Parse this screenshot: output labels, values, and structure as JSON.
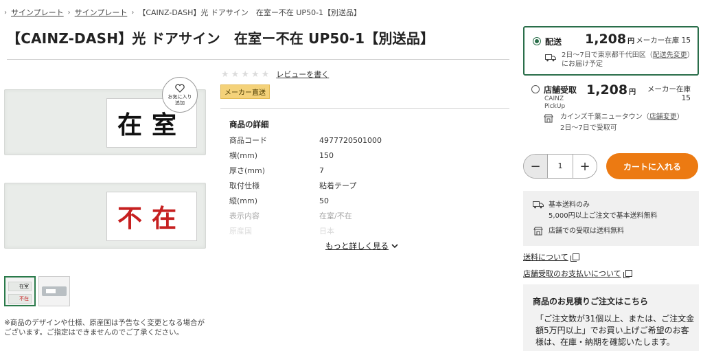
{
  "breadcrumb": {
    "items": [
      "サインプレート",
      "サインプレート",
      "【CAINZ-DASH】光 ドアサイン　在室ー不在 UP50-1【別送品】"
    ]
  },
  "product": {
    "title": "【CAINZ-DASH】光 ドアサイン　在室ー不在 UP50-1【別送品】",
    "image_text_top": "在室",
    "image_text_bottom": "不在",
    "favorite_label_1": "お気に入り",
    "favorite_label_2": "追加",
    "thumbs": [
      {
        "top": "在室",
        "bottom": "不在"
      },
      {
        "top": "",
        "bottom": ""
      }
    ],
    "disclaimer": "※商品のデザインや仕様、原産国は予告なく変更となる場合がございます。ご指定はできませんのでご了承ください。"
  },
  "rating": {
    "stars": 0,
    "review_link": "レビューを書く"
  },
  "badge": "メーカー直送",
  "details": {
    "title": "商品の詳細",
    "rows": [
      {
        "key": "商品コード",
        "value": "4977720501000"
      },
      {
        "key": "横(mm)",
        "value": "150"
      },
      {
        "key": "厚さ(mm)",
        "value": "7"
      },
      {
        "key": "取付仕様",
        "value": "粘着テープ"
      },
      {
        "key": "縦(mm)",
        "value": "50"
      },
      {
        "key": "表示内容",
        "value": "在室/不在"
      },
      {
        "key": "原産国",
        "value": "日本"
      }
    ],
    "more": "もっと詳しく見る"
  },
  "delivery": {
    "label": "配送",
    "price": "1,208",
    "yen": "円",
    "stock": "メーカー在庫 15",
    "note_1": "2日〜7日で東京都千代田区（",
    "note_link": "配送先変更",
    "note_2": "）にお届け予定"
  },
  "pickup": {
    "label": "店舗受取",
    "sub_1": "CAINZ",
    "sub_2": "PickUp",
    "price": "1,208",
    "yen": "円",
    "stock_1": "メーカー在庫",
    "stock_2": "15",
    "store_1": "カインズ千葉ニュータウン（",
    "store_link": "店舗変更",
    "store_2": "）",
    "store_note": "2日〜7日で受取可"
  },
  "cart": {
    "quantity": "1",
    "button": "カートに入れる"
  },
  "shipping": {
    "line1": "基本送料のみ",
    "line2": "5,000円以上ご注文で基本送料無料",
    "line3": "店舗での受取は送料無料"
  },
  "links": {
    "shipping_info": "送料について",
    "pickup_payment": "店舗受取のお支払いについて"
  },
  "quote": {
    "title": "商品のお見積りご注文はこちら",
    "text": "「ご注文数が31個以上、または、ご注文金額5万円以上」でお買い上げご希望のお客様は、在庫・納期を確認いたします。"
  },
  "colors": {
    "accent_green": "#2a6e4a",
    "cart_orange": "#ec7a12",
    "badge_yellow": "#f4d27a"
  }
}
